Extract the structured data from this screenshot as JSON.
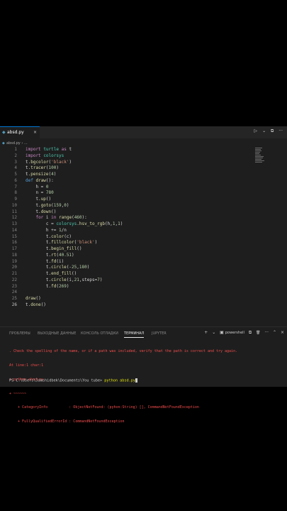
{
  "editor": {
    "tab": {
      "filename": "absd.py",
      "close": "×"
    },
    "breadcrumb": {
      "file": "absd.py",
      "sep": "›",
      "more": "..."
    },
    "actions": {
      "run": "▷",
      "dropdown": "⌄",
      "split": "⧉",
      "more": "···"
    },
    "lines": [
      {
        "n": "1",
        "text": "import turtle as t"
      },
      {
        "n": "2",
        "text": "import colorsys"
      },
      {
        "n": "3",
        "text": "t.bgcolor('black')"
      },
      {
        "n": "4",
        "text": "t.tracer(100)"
      },
      {
        "n": "5",
        "text": "t.pensize(4)"
      },
      {
        "n": "6",
        "text": "def draw():"
      },
      {
        "n": "7",
        "text": "    h = 0"
      },
      {
        "n": "8",
        "text": "    n = 780"
      },
      {
        "n": "9",
        "text": "    t.up()"
      },
      {
        "n": "10",
        "text": "    t.goto(159,0)"
      },
      {
        "n": "11",
        "text": "    t.down()"
      },
      {
        "n": "12",
        "text": "    for i in range(460):"
      },
      {
        "n": "13",
        "text": "        c = colorsys.hsv_to_rgb(h,1,1)"
      },
      {
        "n": "14",
        "text": "        h += 1/n"
      },
      {
        "n": "15",
        "text": "        t.color(c)"
      },
      {
        "n": "16",
        "text": "        t.fillcolor('black')"
      },
      {
        "n": "17",
        "text": "        t.begin_fill()"
      },
      {
        "n": "18",
        "text": "        t.rt(40.51)"
      },
      {
        "n": "19",
        "text": "        t.fd(i)"
      },
      {
        "n": "20",
        "text": "        t.circle(-25,180)"
      },
      {
        "n": "21",
        "text": "        t.end_fill()"
      },
      {
        "n": "22",
        "text": "        t.circle(i,21,steps=7)"
      },
      {
        "n": "23",
        "text": "        t.fd(269)"
      },
      {
        "n": "24",
        "text": ""
      },
      {
        "n": "25",
        "text": "draw()"
      },
      {
        "n": "26",
        "text": "t.done()"
      }
    ]
  },
  "panel": {
    "tabs": [
      "ПРОБЛЕМЫ",
      "ВЫХОДНЫЕ ДАННЫЕ",
      "КОНСОЛЬ ОТЛАДКИ",
      "ТЕРМИНАЛ",
      "JUPYTER"
    ],
    "active_tab": "ТЕРМИНАЛ",
    "tools": {
      "add": "+",
      "add_dropdown": "⌄",
      "shell_label": "powershell",
      "split": "⧉",
      "trash": "🗑",
      "more": "···",
      "maximize": "⌃",
      "close": "×"
    },
    "terminal_lines": [
      ". Check the spelling of the name, or if a path was included, verify that the path is correct and try again.",
      "At line:1 char:1",
      "+ python absd.py",
      "+ ~~~~~~",
      "    + CategoryInfo          : ObjectNotFound: (pyhon:String) [], CommandNotFoundException",
      "    + FullyQualifiedErrorId : CommandNotFoundException"
    ],
    "prompt": "PS C:\\Users\\Jamshidbek\\Documents\\You tube> ",
    "command": "python absd.py"
  }
}
